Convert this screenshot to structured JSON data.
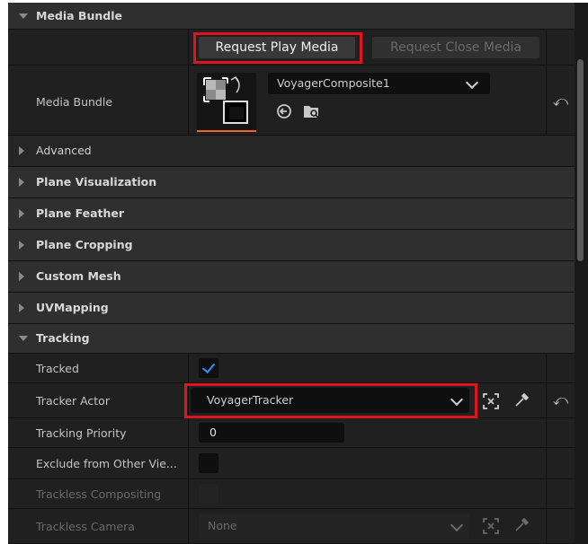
{
  "sections": {
    "media_bundle_header": "Media Bundle",
    "advanced": "Advanced",
    "plane_visualization": "Plane Visualization",
    "plane_feather": "Plane Feather",
    "plane_cropping": "Plane Cropping",
    "custom_mesh": "Custom Mesh",
    "uv_mapping": "UVMapping",
    "tracking": "Tracking"
  },
  "buttons": {
    "request_play": "Request Play Media",
    "request_close": "Request Close Media"
  },
  "media_bundle": {
    "label": "Media Bundle",
    "asset_value": "VoyagerComposite1"
  },
  "tracking": {
    "tracked_label": "Tracked",
    "tracked_checked": true,
    "tracker_actor_label": "Tracker Actor",
    "tracker_actor_value": "VoyagerTracker",
    "tracking_priority_label": "Tracking Priority",
    "tracking_priority_value": "0",
    "exclude_label": "Exclude from Other Vie...",
    "trackless_compositing_label": "Trackless Compositing",
    "trackless_camera_label": "Trackless Camera",
    "trackless_camera_value": "None"
  },
  "colors": {
    "highlight": "#e0141e",
    "checkmark": "#2f8fff",
    "thumbnail_accent": "#e86a24"
  }
}
